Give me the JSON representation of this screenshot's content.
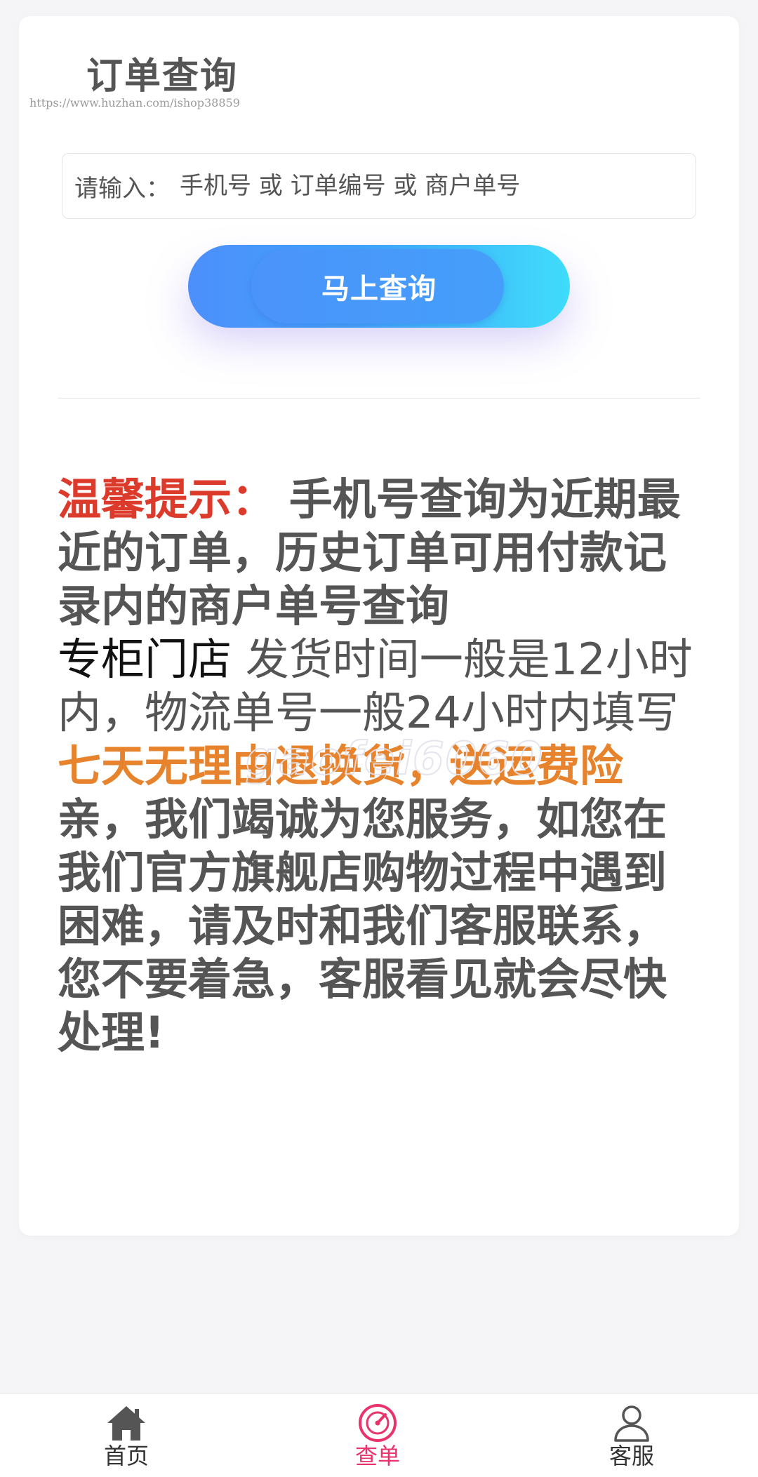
{
  "header": {
    "title": "订单查询",
    "url_watermark": "https://www.huzhan.com/ishop38859"
  },
  "search": {
    "prefix": "请输入：",
    "placeholder": "手机号 或 订单编号 或 商户单号",
    "value": ""
  },
  "query_button": {
    "label": "马上查询"
  },
  "notice": {
    "tip_label": "温馨提示：",
    "tip_text": "手机号查询为近期最近的订单，历史订单可用付款记录内的商户单号查询",
    "store_name": "专柜门店",
    "shipping_text": "发货时间一般是12小时内，物流单号一般24小时内填写",
    "return_policy": "七天无理由退换货，送运费险",
    "service_text": "亲，我们竭诚为您服务，如您在我们官方旗舰店购物过程中遇到困难，请及时和我们客服联系，您不要着急，客服看见就会尽快处理!"
  },
  "center_watermark": "gaofei6060",
  "tabbar": {
    "items": [
      {
        "label": "首页",
        "icon": "home-icon",
        "active": false
      },
      {
        "label": "查单",
        "icon": "order-query-icon",
        "active": true
      },
      {
        "label": "客服",
        "icon": "customer-service-icon",
        "active": false
      }
    ]
  },
  "colors": {
    "tip_red": "#dc3a2b",
    "return_orange": "#e7832d",
    "active_tab": "#e8336c",
    "button_start": "#4c8ffb",
    "button_end": "#3fdcfb"
  }
}
